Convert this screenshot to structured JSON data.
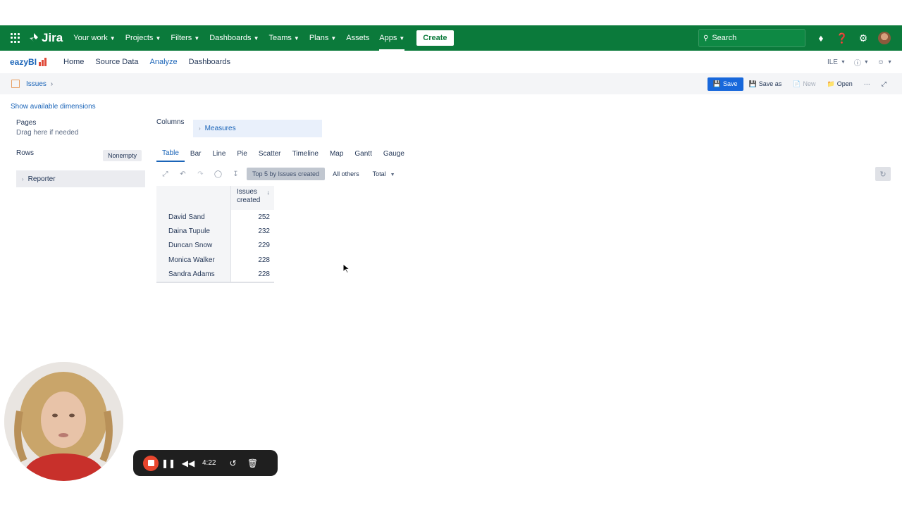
{
  "jira_nav": {
    "logo_text": "Jira",
    "items": [
      {
        "label": "Your work",
        "has_chevron": true
      },
      {
        "label": "Projects",
        "has_chevron": true
      },
      {
        "label": "Filters",
        "has_chevron": true
      },
      {
        "label": "Dashboards",
        "has_chevron": true
      },
      {
        "label": "Teams",
        "has_chevron": true
      },
      {
        "label": "Plans",
        "has_chevron": true
      },
      {
        "label": "Assets",
        "has_chevron": false
      },
      {
        "label": "Apps",
        "has_chevron": true
      }
    ],
    "create_label": "Create",
    "search_placeholder": "Search",
    "brand_color": "#0b7a3b"
  },
  "eazybi_nav": {
    "logo_text": "eazyBI",
    "tabs": [
      "Home",
      "Source Data",
      "Analyze",
      "Dashboards"
    ],
    "active_tab": "Analyze",
    "language": "ILE"
  },
  "toolbar": {
    "breadcrumb": "Issues",
    "save": "Save",
    "save_as": "Save as",
    "new": "New",
    "open": "Open",
    "more": "···"
  },
  "layout_panel": {
    "show_dimensions": "Show available dimensions",
    "pages_title": "Pages",
    "pages_hint": "Drag here if needed",
    "rows_title": "Rows",
    "nonempty": "Nonempty",
    "rows_dimension": "Reporter",
    "columns_title": "Columns",
    "columns_dimension": "Measures"
  },
  "chart_tabs": [
    "Table",
    "Bar",
    "Line",
    "Pie",
    "Scatter",
    "Timeline",
    "Map",
    "Gantt",
    "Gauge"
  ],
  "active_chart_tab": "Table",
  "table_toolbar": {
    "top_filter": "Top 5 by Issues created",
    "others": "All others",
    "total": "Total"
  },
  "table": {
    "column_header_line1": "Issues",
    "column_header_line2": "created",
    "sort_icon": "↓",
    "rows": [
      {
        "name": "David Sand",
        "value": "252"
      },
      {
        "name": "Daina Tupule",
        "value": "232"
      },
      {
        "name": "Duncan Snow",
        "value": "229"
      },
      {
        "name": "Monica Walker",
        "value": "228"
      },
      {
        "name": "Sandra Adams",
        "value": "228"
      }
    ]
  },
  "recorder": {
    "time": "4:22"
  }
}
